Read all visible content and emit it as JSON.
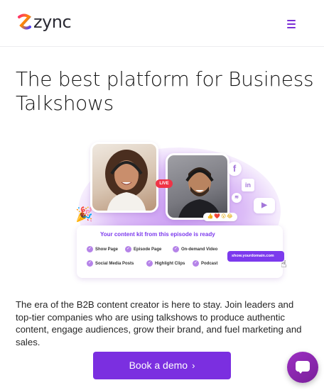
{
  "header": {
    "brand_name": "zync",
    "logo_icon": "z-swirl-logo-icon",
    "menu_icon": "hamburger-menu-icon"
  },
  "hero": {
    "title": "The best platform for Business Talkshows"
  },
  "illustration": {
    "live_label": "LIVE",
    "social_icons": [
      "facebook-icon",
      "linkedin-icon",
      "spotify-icon",
      "youtube-icon"
    ],
    "reactions": "👍❤️😮😂",
    "kit_title": "Your content kit from this episode is ready",
    "kit_items": [
      "Show Page",
      "Episode Page",
      "On-demand Video",
      "Social Media Posts",
      "Highlight Clips",
      "Podcast"
    ],
    "domain_label": "show.yourdomain.com"
  },
  "intro": {
    "text": "The era of the B2B content creator is here to stay. Join leaders and top-tier companies who are using talkshows to produce authentic content, engage audiences, grow their brand, and fuel marketing and sales."
  },
  "cta": {
    "label": "Book a demo",
    "chevron": "›"
  },
  "chat": {
    "icon": "chat-bubble-icon"
  },
  "colors": {
    "accent": "#7b2fe0",
    "logo_gradient": [
      "#ff2d6f",
      "#ff8a00",
      "#4a3aff"
    ]
  }
}
